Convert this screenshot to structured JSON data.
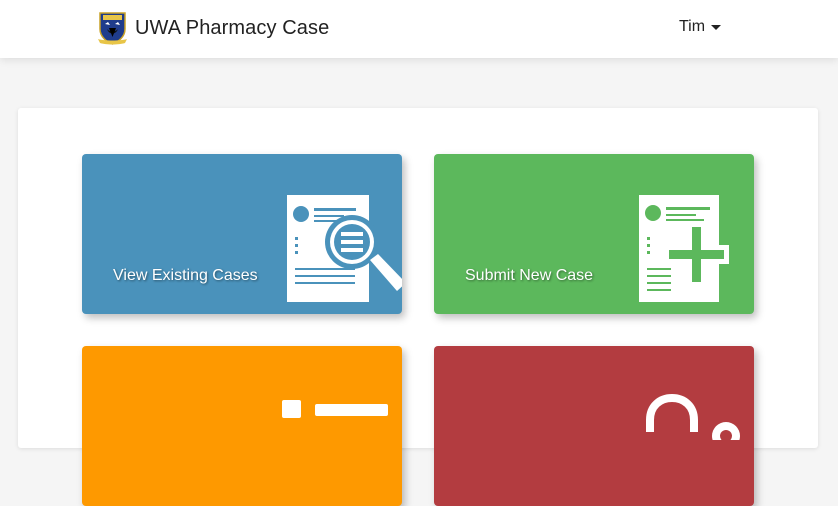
{
  "app": {
    "title": "UWA Pharmacy Case"
  },
  "user": {
    "name": "Tim"
  },
  "colors": {
    "view_tile": "#4a92bb",
    "submit_tile": "#5cb85c",
    "orange_tile": "#fe9900",
    "red_tile": "#b33c40"
  },
  "tiles": [
    {
      "label": "View Existing Cases",
      "icon": "document-search-icon"
    },
    {
      "label": "Submit New Case",
      "icon": "document-add-icon"
    },
    {
      "label": "",
      "icon": "id-card-icon"
    },
    {
      "label": "",
      "icon": "lock-icon"
    }
  ]
}
